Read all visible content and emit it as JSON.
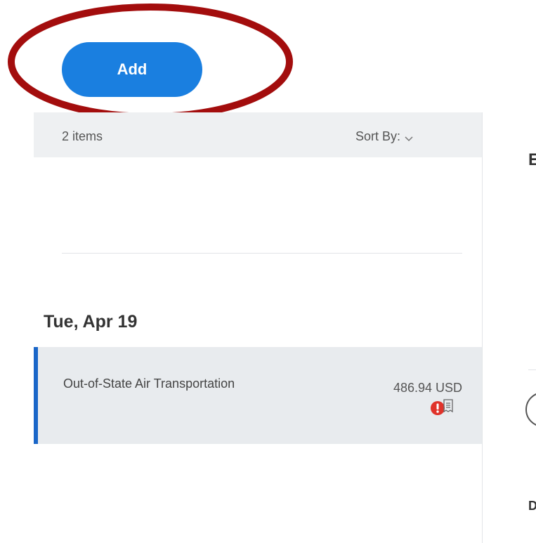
{
  "toolbar": {
    "add_label": "Add"
  },
  "list": {
    "count_text": "2 items",
    "sort_label": "Sort By:"
  },
  "groups": [
    {
      "date": "Tue, Apr 19",
      "items": [
        {
          "title": "Out-of-State Air Transportation",
          "amount": "486.94 USD",
          "has_error": true,
          "has_receipt": true
        }
      ]
    }
  ],
  "detail_panel": {
    "heading_partial": "E",
    "label_partial": "D"
  },
  "colors": {
    "accent": "#1a7fe0",
    "annotation": "#a30d0d",
    "error": "#e0332b",
    "row_bg": "#e8ebee"
  }
}
